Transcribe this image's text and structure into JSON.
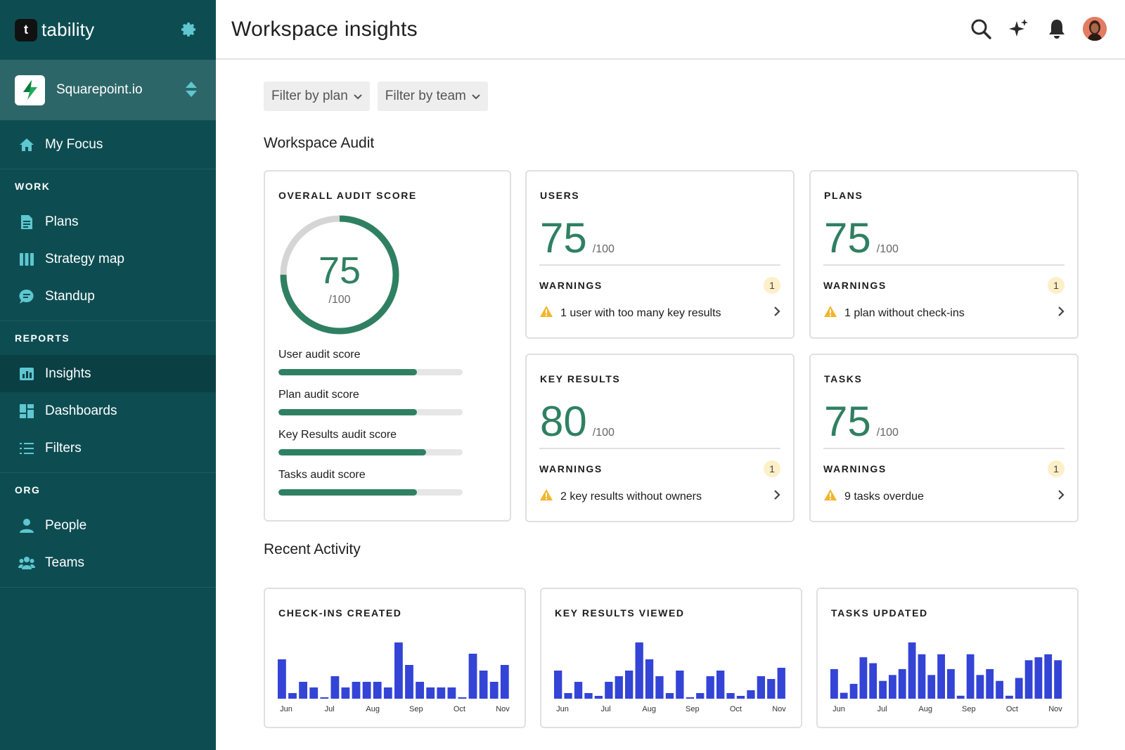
{
  "brand": {
    "name": "tability",
    "logo_glyph": "t"
  },
  "workspace": {
    "name": "Squarepoint.io"
  },
  "sidebar": {
    "focus": {
      "label": "My Focus",
      "icon": "home-icon"
    },
    "sections": [
      {
        "heading": "WORK",
        "items": [
          {
            "label": "Plans",
            "icon": "document-icon"
          },
          {
            "label": "Strategy map",
            "icon": "columns-icon"
          },
          {
            "label": "Standup",
            "icon": "chat-icon"
          }
        ]
      },
      {
        "heading": "REPORTS",
        "items": [
          {
            "label": "Insights",
            "icon": "chart-icon",
            "active": true
          },
          {
            "label": "Dashboards",
            "icon": "dashboard-icon"
          },
          {
            "label": "Filters",
            "icon": "list-icon"
          }
        ]
      },
      {
        "heading": "ORG",
        "items": [
          {
            "label": "People",
            "icon": "person-icon"
          },
          {
            "label": "Teams",
            "icon": "team-icon"
          }
        ]
      }
    ]
  },
  "header": {
    "title": "Workspace insights"
  },
  "filters": {
    "plan": "Filter by plan",
    "team": "Filter by team"
  },
  "audit": {
    "title": "Workspace Audit",
    "overall": {
      "label": "OVERALL AUDIT SCORE",
      "score": "75",
      "denominator": "/100",
      "score_fraction": 0.75,
      "bars": [
        {
          "label": "User audit score",
          "value": 0.75
        },
        {
          "label": "Plan audit score",
          "value": 0.75
        },
        {
          "label": "Key Results audit score",
          "value": 0.8
        },
        {
          "label": "Tasks audit score",
          "value": 0.75
        }
      ]
    },
    "cards": [
      {
        "label": "USERS",
        "score": "75",
        "denominator": "/100",
        "warnings_label": "WARNINGS",
        "warnings_count": "1",
        "warning_text": "1 user with too many key results"
      },
      {
        "label": "PLANS",
        "score": "75",
        "denominator": "/100",
        "warnings_label": "WARNINGS",
        "warnings_count": "1",
        "warning_text": "1 plan without check-ins"
      },
      {
        "label": "KEY RESULTS",
        "score": "80",
        "denominator": "/100",
        "warnings_label": "WARNINGS",
        "warnings_count": "1",
        "warning_text": "2 key results without owners"
      },
      {
        "label": "TASKS",
        "score": "75",
        "denominator": "/100",
        "warnings_label": "WARNINGS",
        "warnings_count": "1",
        "warning_text": "9 tasks overdue"
      }
    ]
  },
  "activity": {
    "title": "Recent Activity",
    "bar_color": "#3344d6",
    "accent_color": "#2f8062"
  },
  "chart_data": [
    {
      "type": "bar",
      "title": "CHECK-INS CREATED",
      "x_tick_labels": [
        "Jun",
        "Jul",
        "Aug",
        "Sep",
        "Oct",
        "Nov"
      ],
      "values": [
        7,
        1,
        3,
        2,
        0,
        4,
        2,
        3,
        3,
        3,
        2,
        10,
        6,
        3,
        2,
        2,
        2,
        0,
        8,
        5,
        3,
        6
      ]
    },
    {
      "type": "bar",
      "title": "KEY RESULTS VIEWED",
      "x_tick_labels": [
        "Jun",
        "Jul",
        "Aug",
        "Sep",
        "Oct",
        "Nov"
      ],
      "values": [
        5,
        1,
        3,
        1,
        0.5,
        3,
        4,
        5,
        10,
        7,
        4,
        1,
        5,
        0,
        1,
        4,
        5,
        1,
        0.5,
        1.5,
        4,
        3.5,
        5.5
      ]
    },
    {
      "type": "bar",
      "title": "TASKS UPDATED",
      "x_tick_labels": [
        "Jun",
        "Jul",
        "Aug",
        "Sep",
        "Oct",
        "Nov"
      ],
      "values": [
        5,
        1,
        2.5,
        7,
        6,
        3,
        4,
        5,
        9.5,
        7.5,
        4,
        7.5,
        5,
        0.5,
        7.5,
        4,
        5,
        3,
        0.5,
        3.5,
        6.5,
        7,
        7.5,
        6.5
      ]
    }
  ]
}
